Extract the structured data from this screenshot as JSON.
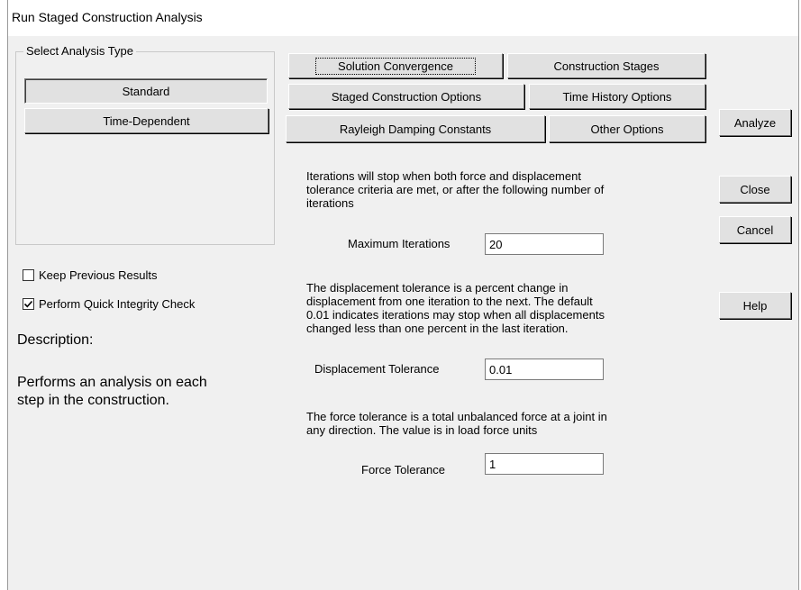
{
  "window": {
    "title": "Run Staged Construction Analysis"
  },
  "analysis_type": {
    "group_label": "Select Analysis Type",
    "standard_label": "Standard",
    "time_dependent_label": "Time-Dependent"
  },
  "options": {
    "keep_previous_label": "Keep Previous Results",
    "keep_previous_checked": false,
    "quick_check_label": "Perform Quick Integrity Check",
    "quick_check_checked": true
  },
  "description": {
    "heading": "Description:",
    "line1": "Performs an analysis on each",
    "line2": "step in the construction."
  },
  "tabs": {
    "solution_convergence": "Solution Convergence",
    "construction_stages": "Construction Stages",
    "staged_construction_options": "Staged Construction Options",
    "time_history_options": "Time History Options",
    "rayleigh_damping": "Rayleigh Damping Constants",
    "other_options": "Other Options"
  },
  "convergence": {
    "iterations_text": {
      "line1": "Iterations will stop when both force and displacement",
      "line2": "tolerance criteria are met, or after the following number of",
      "line3": "iterations"
    },
    "max_iterations_label": "Maximum Iterations",
    "max_iterations_value": "20",
    "displacement_text": {
      "line1": "The displacement tolerance is a percent change in",
      "line2": "displacement from one iteration to the next.  The default",
      "line3": "0.01 indicates iterations may stop when all displacements",
      "line4": "changed less than one percent in the last iteration."
    },
    "displacement_tolerance_label": "Displacement Tolerance",
    "displacement_tolerance_value": "0.01",
    "force_text": {
      "line1": "The force tolerance is a total unbalanced force at a joint in",
      "line2": "any direction.  The value is in load force units"
    },
    "force_tolerance_label": "Force Tolerance",
    "force_tolerance_value": "1"
  },
  "actions": {
    "analyze": "Analyze",
    "close": "Close",
    "cancel": "Cancel",
    "help": "Help"
  }
}
